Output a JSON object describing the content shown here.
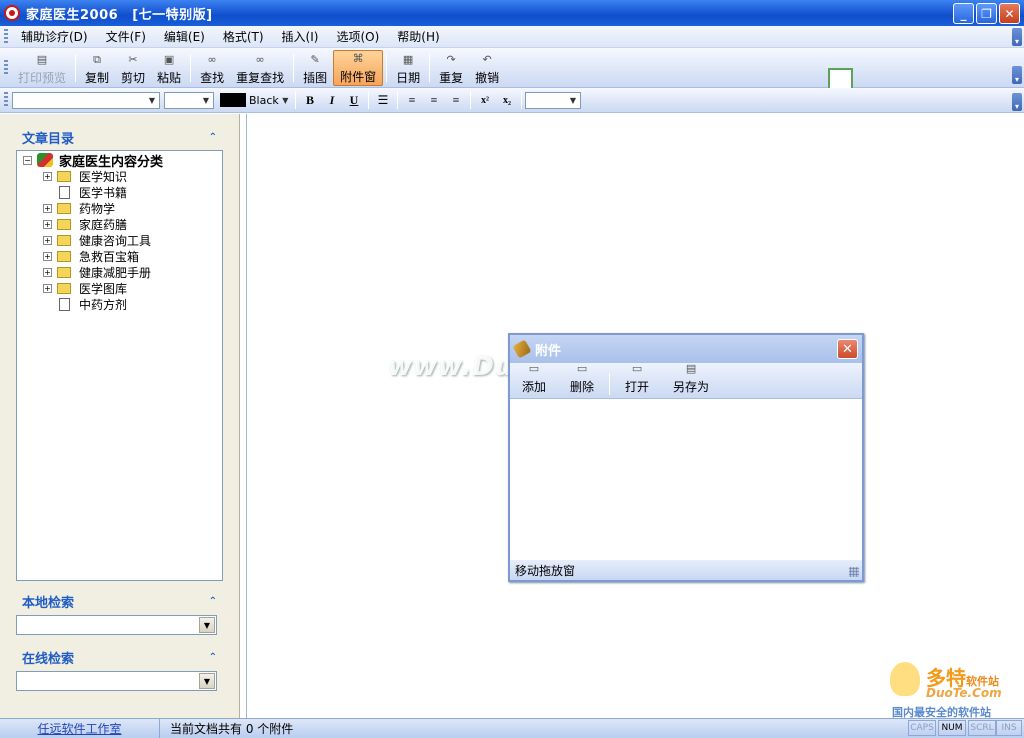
{
  "window": {
    "title": "家庭医生2006",
    "edition": "[七一特别版]"
  },
  "menu": [
    "辅助诊疗(D)",
    "文件(F)",
    "编辑(E)",
    "格式(T)",
    "插入(I)",
    "选项(O)",
    "帮助(H)"
  ],
  "toolbar": {
    "print_preview": "打印预览",
    "copy": "复制",
    "cut": "剪切",
    "paste": "粘贴",
    "find": "查找",
    "find_again": "重复查找",
    "insert_image": "插图",
    "attachment_window": "附件窗",
    "date": "日期",
    "redo": "重复",
    "undo": "撤销"
  },
  "format": {
    "font_name": "",
    "font_size": "",
    "color_name": "Black",
    "color_value": "#000000",
    "zoom": "",
    "bold": "B",
    "italic": "I",
    "underline": "U",
    "superscript": "x²",
    "subscript": "x₂"
  },
  "left": {
    "catalog_title": "文章目录",
    "tree_root": "家庭医生内容分类",
    "tree_items": [
      {
        "label": "医学知识",
        "type": "folder",
        "expandable": true
      },
      {
        "label": "医学书籍",
        "type": "doc",
        "expandable": false
      },
      {
        "label": "药物学",
        "type": "folder",
        "expandable": true
      },
      {
        "label": "家庭药膳",
        "type": "folder",
        "expandable": true
      },
      {
        "label": "健康咨询工具",
        "type": "folder",
        "expandable": true
      },
      {
        "label": "急救百宝箱",
        "type": "folder",
        "expandable": true
      },
      {
        "label": "健康减肥手册",
        "type": "folder",
        "expandable": true
      },
      {
        "label": "医学图库",
        "type": "folder",
        "expandable": true
      },
      {
        "label": "中药方剂",
        "type": "doc",
        "expandable": false
      }
    ],
    "local_search_title": "本地检索",
    "online_search_title": "在线检索"
  },
  "attachment_dialog": {
    "title": "附件",
    "add": "添加",
    "delete": "删除",
    "open": "打开",
    "save_as": "另存为",
    "status": "移动拖放窗"
  },
  "statusbar": {
    "link": "任远软件工作室",
    "text": "当前文档共有 0 个附件",
    "indicators": [
      "CAPS",
      "NUM",
      "SCRL",
      "INS"
    ]
  },
  "watermark": "www.DuoTe.com",
  "logo": {
    "brand": "多特",
    "suffix": "软件站",
    "domain": "DuoTe.Com",
    "slogan": "国内最安全的软件站"
  },
  "colors": {
    "titlebar": "#1b5ad6",
    "accent": "#215dc6",
    "active_button": "#f6a45a"
  }
}
